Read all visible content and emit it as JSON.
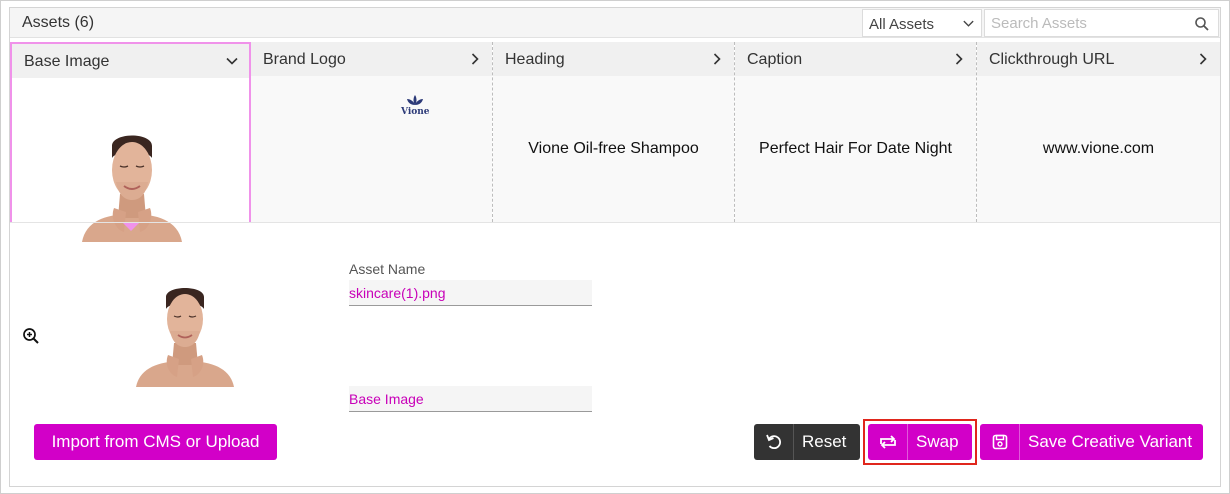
{
  "header": {
    "title": "Assets (6)",
    "filter_value": "All Assets",
    "search_placeholder": "Search Assets"
  },
  "tabs": [
    {
      "label": "Base Image",
      "state": "expanded"
    },
    {
      "label": "Brand Logo",
      "logo_text": "Vione"
    },
    {
      "label": "Heading",
      "content": "Vione Oil-free Shampoo"
    },
    {
      "label": "Caption",
      "content": "Perfect Hair For Date Night"
    },
    {
      "label": "Clickthrough URL",
      "content": "www.vione.com"
    }
  ],
  "detail": {
    "asset_name_label": "Asset Name",
    "asset_name_value": "skincare(1).png",
    "asset_type_value": "Base Image"
  },
  "buttons": {
    "import": "Import from CMS or Upload",
    "reset": "Reset",
    "swap": "Swap",
    "save": "Save Creative Variant"
  },
  "colors": {
    "accent": "#d200c8",
    "active_tab_border": "#f092ea",
    "highlight": "#e0261c",
    "dark_button": "#333333",
    "logo": "#2c3a78"
  },
  "icons": {
    "filter": "chevron-down-icon",
    "search": "search-icon",
    "expanded_tab": "chevron-down-icon",
    "collapsed_tab": "chevron-right-icon",
    "zoom": "zoom-in-icon",
    "reset": "undo-icon",
    "swap": "swap-icon",
    "save": "save-icon"
  }
}
